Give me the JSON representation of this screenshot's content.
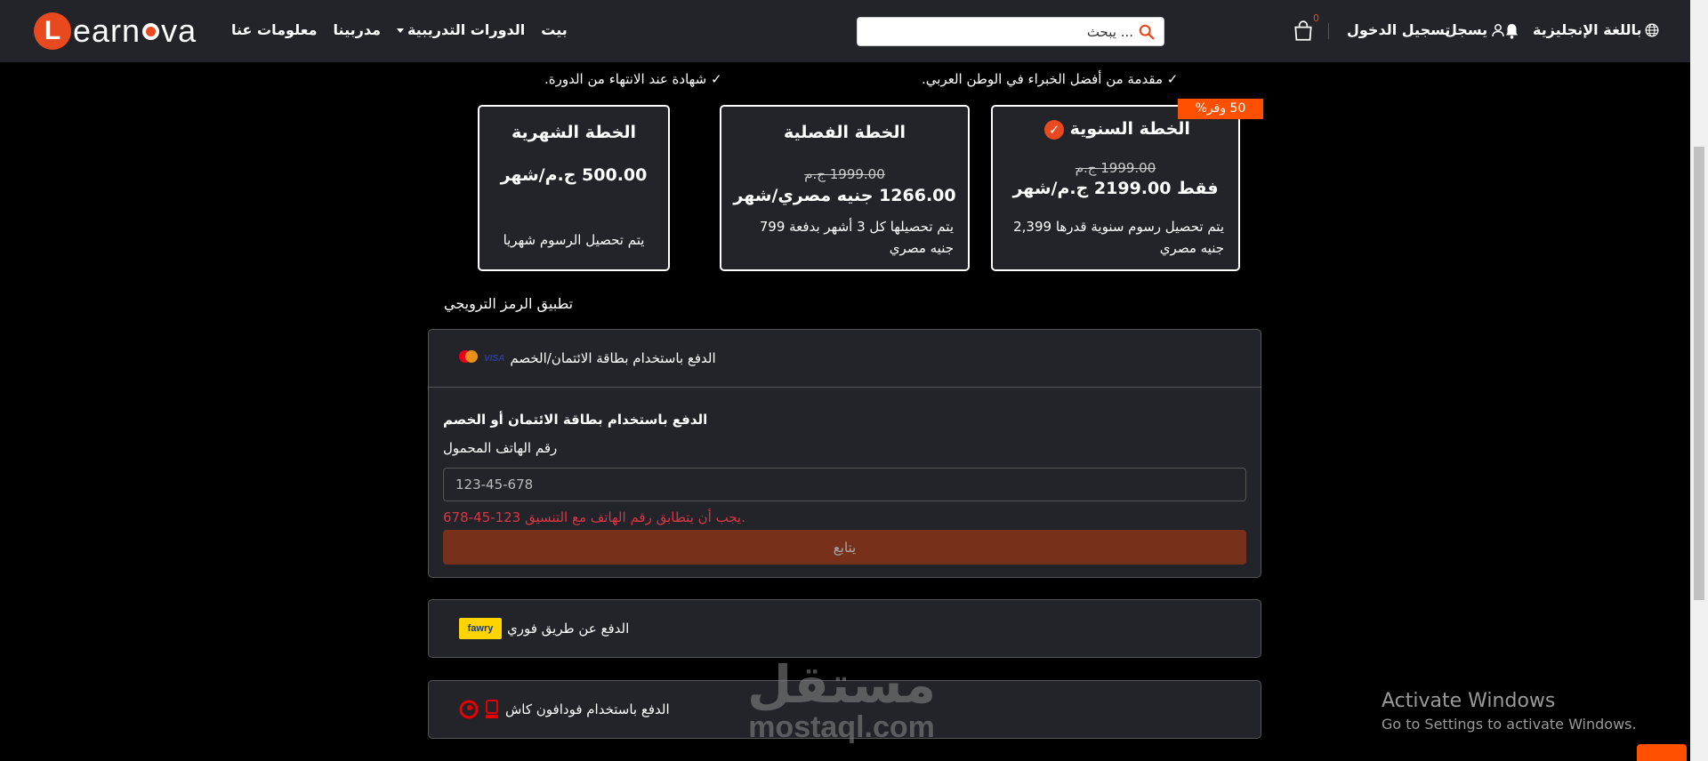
{
  "brand": {
    "logo_letter": "L",
    "logo_text_start": "earn",
    "logo_text_end": "va"
  },
  "nav": {
    "links": [
      "بيت",
      "الدورات التدريبية",
      "مدربينا",
      "معلومات عنا"
    ],
    "search_placeholder": "... يبحث",
    "cart_count": "0",
    "login": "تسجيل الدخول",
    "register": "يسجل",
    "language": "باللغة الإنجليزية"
  },
  "features": [
    "مقدمة من أفضل الخبراء في الوطن العربي.",
    "شهادة عند الانتهاء من الدورة."
  ],
  "checkmark": "✓",
  "plans": {
    "annual": {
      "title": "الخطة السنوية",
      "check": "✓",
      "old_price": "1999.00 ج.م",
      "price": "فقط 2199.00 ج.م/شهر",
      "desc": "يتم تحصيل رسوم سنوية قدرها 2,399 جنيه مصري",
      "badge": "50 وفر%"
    },
    "quarterly": {
      "title": "الخطة الفصلية",
      "old_price": "1999.00 ج.م",
      "price": "1266.00 جنيه مصري/شهر",
      "desc": "يتم تحصيلها كل 3 أشهر بدفعة 799 جنيه مصري"
    },
    "monthly": {
      "title": "الخطة الشهرية",
      "price": "500.00 ج.م/شهر",
      "desc": "يتم تحصيل الرسوم شهريا"
    }
  },
  "promo_label": "تطبيق الرمز الترويجي",
  "payment": {
    "card": {
      "header": "الدفع باستخدام بطاقة الائتمان/الخصم",
      "visa_text": "VISA",
      "form_title": "الدفع باستخدام بطاقة الائتمان أو الخصم",
      "phone_label": "رقم الهاتف المحمول",
      "phone_placeholder": "123-45-678",
      "error": "يجب أن يتطابق رقم الهاتف مع التنسيق 123-45-678.",
      "continue": "يتابع"
    },
    "fawry": {
      "header": "الدفع عن طريق فوري",
      "logo_text": "fawry"
    },
    "vodafone": {
      "header": "الدفع باستخدام فودافون كاش"
    }
  },
  "watermark": {
    "ar": "مستقل",
    "en": "mostaql.com"
  },
  "windows": {
    "title": "Activate Windows",
    "subtitle": "Go to Settings to activate Windows."
  },
  "colors": {
    "accent": "#e8491e",
    "panel": "#222429",
    "error": "#dc3545",
    "badge": "#ff4f00"
  }
}
